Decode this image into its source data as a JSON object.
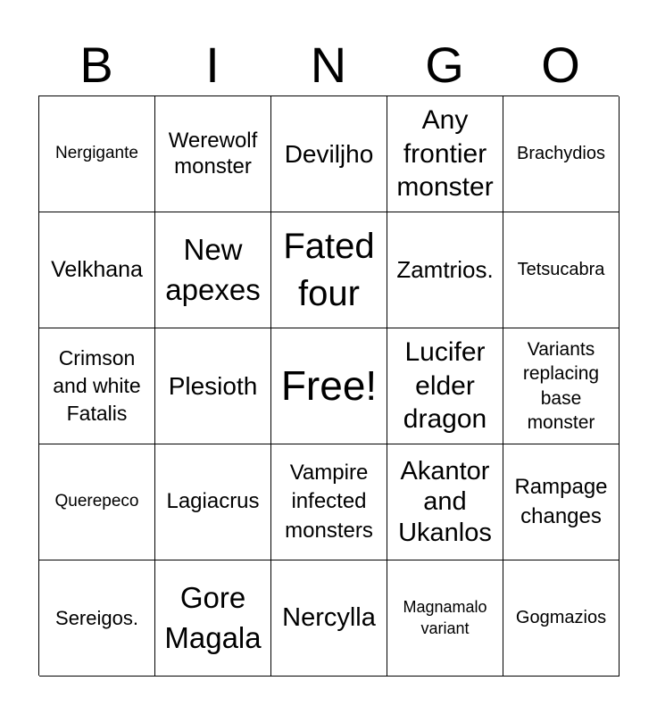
{
  "header": {
    "letters": [
      "B",
      "I",
      "N",
      "G",
      "O"
    ]
  },
  "board": {
    "rows": [
      [
        "Nergigante",
        "Werewolf monster",
        "Deviljho",
        "Any frontier monster",
        "Brachydios"
      ],
      [
        "Velkhana",
        "New apexes",
        "Fated four",
        "Zamtrios.",
        "Tetsucabra"
      ],
      [
        "Crimson and white Fatalis",
        "Plesioth",
        "Free!",
        "Lucifer elder dragon",
        "Variants replacing base monster"
      ],
      [
        "Querepeco",
        "Lagiacrus",
        "Vampire infected monsters",
        "Akantor and Ukanlos",
        "Rampage changes"
      ],
      [
        "Sereigos.",
        "Gore Magala",
        "Nercylla",
        "Magnamalo variant",
        "Gogmazios"
      ]
    ],
    "free_space": "Free!"
  }
}
